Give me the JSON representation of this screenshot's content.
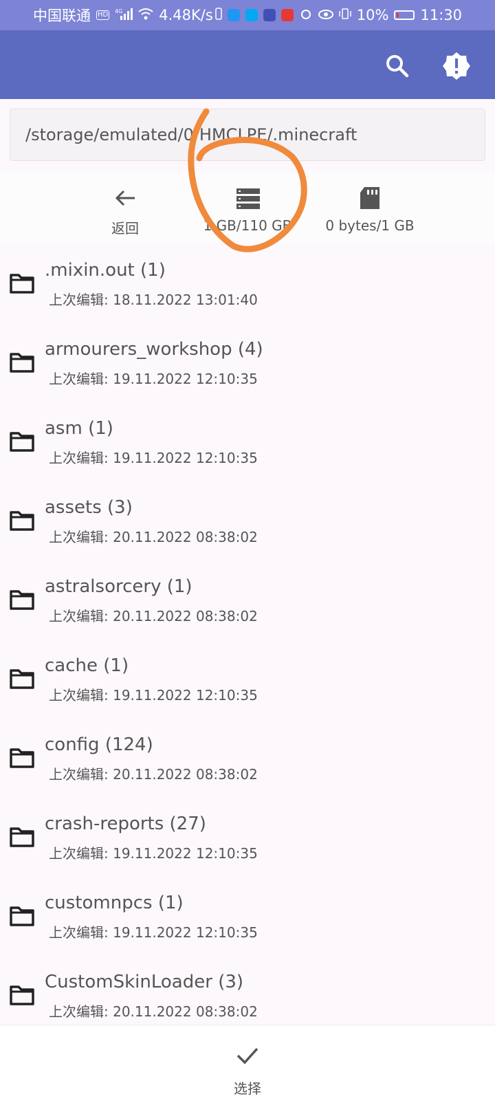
{
  "status_bar": {
    "carrier": "中国联通",
    "network": "4G",
    "speed": "4.48K/s",
    "battery": "10%",
    "time": "11:30",
    "icons": [
      "hd-icon",
      "signal-icon",
      "wifi-icon",
      "phone-icon",
      "bulb-app-icon",
      "search-app-icon",
      "play-app-icon",
      "book-app-icon",
      "alarm-icon",
      "eye-icon",
      "vibrate-icon",
      "battery-icon"
    ]
  },
  "app_bar": {
    "icons": [
      "search-icon",
      "alert-badge-icon"
    ],
    "color": "#5c6bc0"
  },
  "path": "/storage/emulated/0/HMCLPE/.minecraft",
  "actions": [
    {
      "icon": "arrow-left-icon",
      "label": "返回"
    },
    {
      "icon": "storage-icon",
      "label": "1 GB/110 GB"
    },
    {
      "icon": "sd-card-icon",
      "label": "0 bytes/1 GB"
    }
  ],
  "files": [
    {
      "name": ".mixin.out (1)",
      "meta": "上次编辑: 18.11.2022 13:01:40"
    },
    {
      "name": "armourers_workshop (4)",
      "meta": "上次编辑: 19.11.2022 12:10:35"
    },
    {
      "name": "asm (1)",
      "meta": "上次编辑: 19.11.2022 12:10:35"
    },
    {
      "name": "assets (3)",
      "meta": "上次编辑: 20.11.2022 08:38:02"
    },
    {
      "name": "astralsorcery (1)",
      "meta": "上次编辑: 20.11.2022 08:38:02"
    },
    {
      "name": "cache (1)",
      "meta": "上次编辑: 19.11.2022 12:10:35"
    },
    {
      "name": "config (124)",
      "meta": "上次编辑: 20.11.2022 08:38:02"
    },
    {
      "name": "crash-reports (27)",
      "meta": "上次编辑: 19.11.2022 12:10:35"
    },
    {
      "name": "customnpcs (1)",
      "meta": "上次编辑: 19.11.2022 12:10:35"
    },
    {
      "name": "CustomSkinLoader (3)",
      "meta": "上次编辑: 20.11.2022 08:38:02"
    }
  ],
  "bottom": {
    "icon": "check-icon",
    "label": "选择"
  },
  "annotation_color": "#f08a3c"
}
